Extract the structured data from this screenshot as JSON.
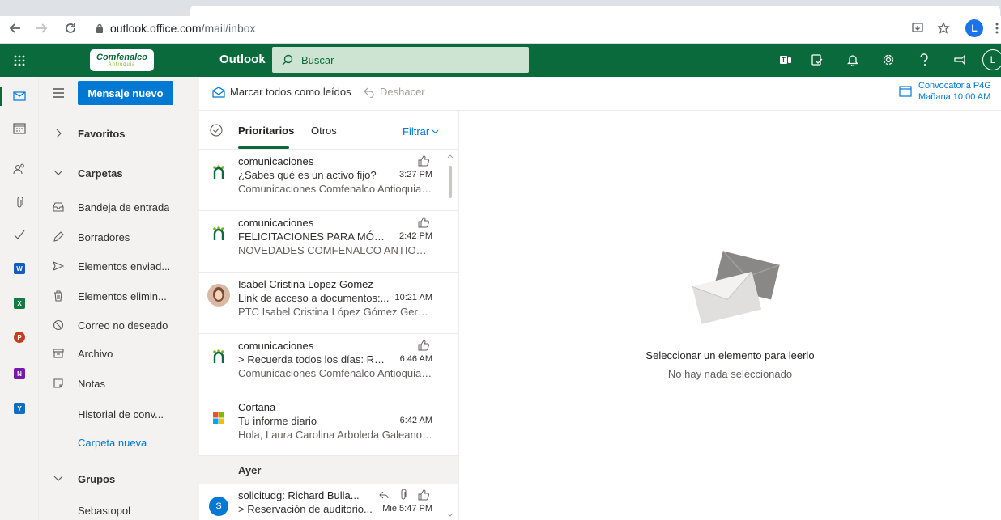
{
  "browser": {
    "url_host": "outlook.office.com",
    "url_path": "/mail/inbox",
    "profile_initial": "L"
  },
  "topbar": {
    "logo_text": "Comfenalco",
    "logo_sub": "Antioquia",
    "app_name": "Outlook",
    "search_placeholder": "Buscar",
    "avatar_initial": "L",
    "brand_color": "#0b6a3c"
  },
  "rail": {
    "items": [
      "mail-icon",
      "calendar-icon",
      "people-icon",
      "attachment-icon",
      "todo-icon",
      "word-icon",
      "excel-icon",
      "powerpoint-icon",
      "onenote-icon",
      "yammer-icon"
    ]
  },
  "folders": {
    "new_message_label": "Mensaje nuevo",
    "favorites_label": "Favoritos",
    "folders_label": "Carpetas",
    "items": [
      {
        "label": "Bandeja de entrada",
        "icon": "inbox-icon"
      },
      {
        "label": "Borradores",
        "icon": "pencil-icon"
      },
      {
        "label": "Elementos enviad...",
        "icon": "send-icon"
      },
      {
        "label": "Elementos elimin...",
        "icon": "trash-icon"
      },
      {
        "label": "Correo no deseado",
        "icon": "block-icon"
      },
      {
        "label": "Archivo",
        "icon": "archive-icon"
      },
      {
        "label": "Notas",
        "icon": "note-icon"
      },
      {
        "label": "Historial de conv...",
        "icon": ""
      }
    ],
    "new_folder_label": "Carpeta nueva",
    "groups_label": "Grupos",
    "group_items": [
      "Sebastopol"
    ]
  },
  "command_bar": {
    "mark_all_read": "Marcar todos como leídos",
    "undo": "Deshacer",
    "reminder_title": "Convocatoria P4G",
    "reminder_time": "Mañana 10:00 AM"
  },
  "message_list": {
    "pivot_focused": "Prioritarios",
    "pivot_other": "Otros",
    "filter_label": "Filtrar",
    "messages": [
      {
        "sender": "comunicaciones",
        "subject": "¿Sabes qué es un activo fijo?",
        "time": "3:27 PM",
        "preview": "Comunicaciones Comfenalco Antioquia c...",
        "avatar": "comfenalco-icon"
      },
      {
        "sender": "comunicaciones",
        "subject": "FELICITACIONES PARA MÓNIC...",
        "time": "2:42 PM",
        "preview": "NOVEDADES COMFENALCO ANTIOQUIA...",
        "avatar": "comfenalco-icon"
      },
      {
        "sender": "Isabel Cristina Lopez Gomez",
        "subject": "Link de acceso a documentos:...",
        "time": "10:21 AM",
        "preview": "PTC Isabel Cristina López Gómez Gerente...",
        "avatar": "photo"
      },
      {
        "sender": "comunicaciones",
        "subject": "> Recuerda todos los días: Rea...",
        "time": "6:46 AM",
        "preview": "Comunicaciones Comfenalco Antioquia c...",
        "avatar": "comfenalco-icon"
      },
      {
        "sender": "Cortana",
        "subject": "Tu informe diario",
        "time": "6:42 AM",
        "preview": "Hola, Laura Carolina Arboleda Galeano: ¡...",
        "avatar": "microsoft-icon"
      }
    ],
    "yesterday_label": "Ayer",
    "yesterday_messages": [
      {
        "sender": "solicitudg: Richard Bulla...",
        "subject": "> Reservación de auditorio...",
        "time": "Mié 5:47 PM",
        "avatar_initial": "S"
      }
    ]
  },
  "reading_pane": {
    "title": "Seleccionar un elemento para leerlo",
    "subtitle": "No hay nada seleccionado"
  }
}
